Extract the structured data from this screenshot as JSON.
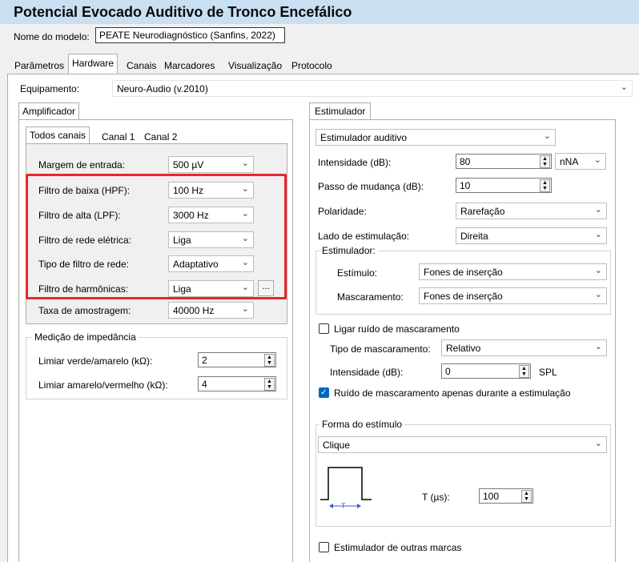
{
  "window": {
    "title": "Potencial Evocado Auditivo de Tronco Encefálico"
  },
  "model": {
    "label": "Nome do modelo:",
    "value": "PEATE Neurodiagnóstico (Sanfins, 2022)"
  },
  "tabs": [
    "Parâmetros",
    "Hardware",
    "Canais",
    "Marcadores",
    "Visualização",
    "Protocolo"
  ],
  "equipment": {
    "label": "Equipamento:",
    "value": "Neuro-Audio (v.2010)"
  },
  "amplifier": {
    "title": "Amplificador",
    "channel_tabs": [
      "Todos canais",
      "Canal 1",
      "Canal 2"
    ],
    "fields": [
      {
        "label": "Margem de entrada:",
        "value": "500 µV"
      },
      {
        "label": "Filtro de baixa (HPF):",
        "value": "100 Hz"
      },
      {
        "label": "Filtro de alta (LPF):",
        "value": "3000 Hz"
      },
      {
        "label": "Filtro de rede elétrica:",
        "value": "Liga"
      },
      {
        "label": "Tipo de filtro de rede:",
        "value": "Adaptativo"
      },
      {
        "label": "Filtro de harmônicas:",
        "value": "Liga"
      },
      {
        "label": "Taxa de amostragem:",
        "value": "40000 Hz"
      }
    ],
    "ellipsis": "...",
    "impedance": {
      "title": "Medição de impedância",
      "green_yellow_label": "Limiar verde/amarelo (kΩ):",
      "green_yellow_value": "2",
      "yellow_red_label": "Limiar amarelo/vermelho (kΩ):",
      "yellow_red_value": "4"
    }
  },
  "stimulator": {
    "title": "Estimulador",
    "type_value": "Estimulador auditivo",
    "intensity_label": "Intensidade (dB):",
    "intensity_value": "80",
    "intensity_unit": "nNA",
    "step_label": "Passo de mudança (dB):",
    "step_value": "10",
    "polarity_label": "Polaridade:",
    "polarity_value": "Rarefação",
    "side_label": "Lado de estimulação:",
    "side_value": "Direita",
    "sub_title": "Estimulador:",
    "stimulus_label": "Estímulo:",
    "stimulus_value": "Fones de inserção",
    "masking_label": "Mascaramento:",
    "masking_value": "Fones de inserção",
    "noise_checkbox": "Ligar ruído de mascaramento",
    "noise_type_label": "Tipo de mascaramento:",
    "noise_type_value": "Relativo",
    "noise_intensity_label": "Intensidade (dB):",
    "noise_intensity_value": "0",
    "noise_intensity_unit": "SPL",
    "noise_only_label": "Ruído de mascaramento apenas durante a estimulação",
    "shape_title": "Forma do estímulo",
    "shape_value": "Clique",
    "t_label": "T (µs):",
    "t_value": "100",
    "waveform_t": "T",
    "other_brands_label": "Estimulador de outras marcas"
  }
}
